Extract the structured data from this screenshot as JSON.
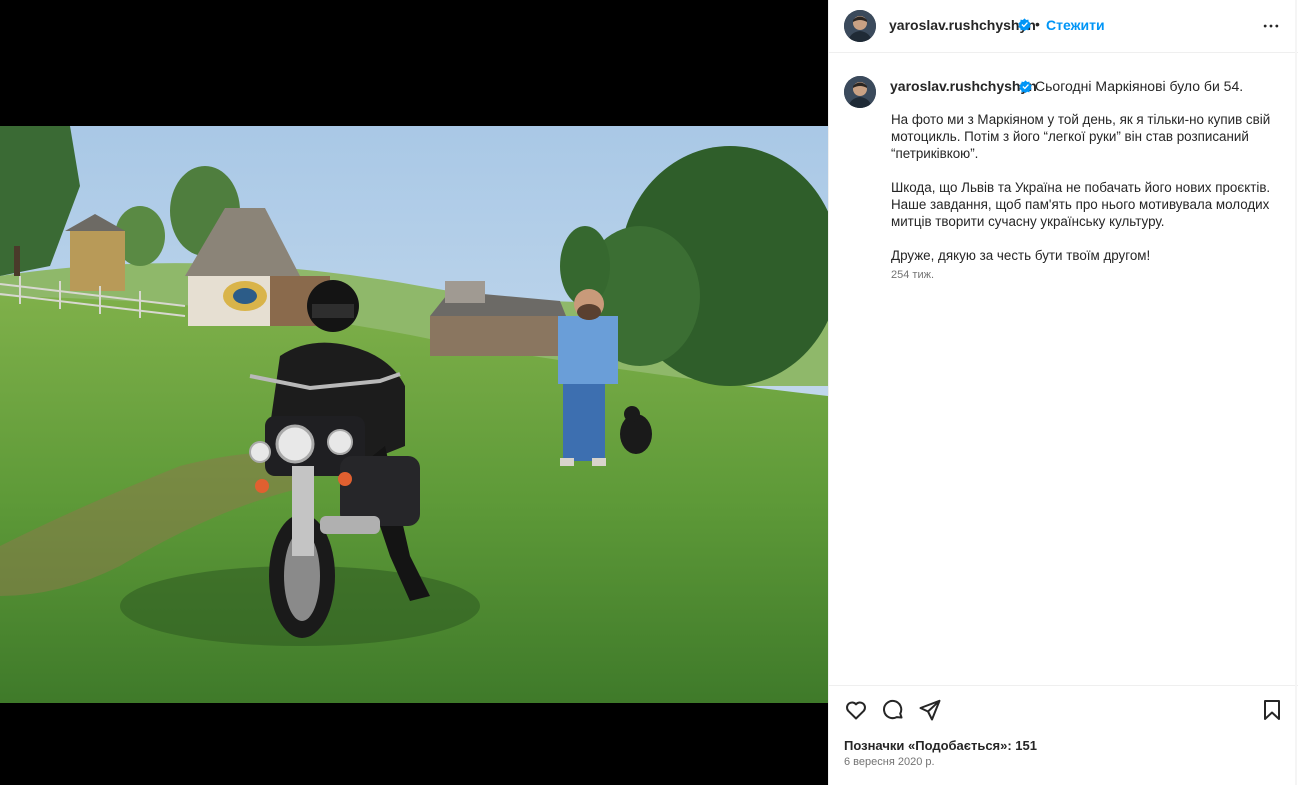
{
  "post": {
    "username": "yaroslav.rushchyshyn",
    "dot": "•",
    "follow_label": "Стежити",
    "caption_first": "Сьогодні Маркіянові було би 54.",
    "caption_paragraphs": [
      "На фото ми з Маркіяном у той день, як я тільки-но купив свій мотоцикль. Потім з його “легкої руки” він став розписаний “петриківкою”.",
      "Шкода, що Львів та Україна не побачать його нових проєктів. Наше завдання, щоб пам'ять про нього мотивувала молодих митців творити сучасну українську культуру.",
      "Друже, дякую за честь бути твоїм другом!"
    ],
    "time_ago": "254 тиж.",
    "likes_text": "Позначки «Подобається»: 151",
    "date": "6 вересня 2020 р."
  },
  "icons": {
    "verified": "verified-badge-icon",
    "more": "more-options-icon",
    "like": "heart-icon",
    "comment": "comment-icon",
    "share": "share-icon",
    "save": "bookmark-icon"
  },
  "colors": {
    "accent": "#0095f6",
    "text": "#262626",
    "secondary": "#737373",
    "divider": "#efefef",
    "media_background": "#000000"
  }
}
